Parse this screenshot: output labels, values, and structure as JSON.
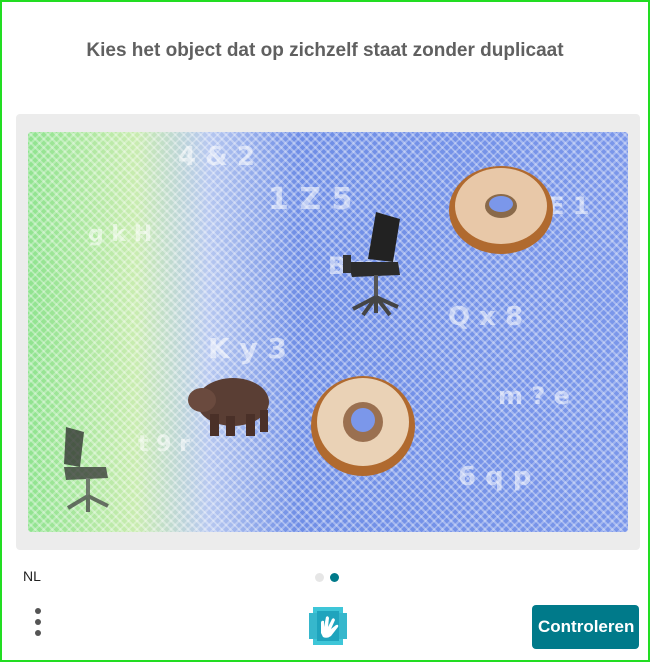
{
  "challenge": {
    "prompt": "Kies het object dat op zichzelf staat zonder duplicaat",
    "objects": [
      "donut",
      "office-chair",
      "donut",
      "hippo",
      "office-chair"
    ]
  },
  "footer": {
    "language": "NL",
    "page_indicator": {
      "total": 2,
      "current": 2
    },
    "verify_label": "Controleren"
  },
  "colors": {
    "accent": "#007a8a",
    "frame": "#22dd22"
  }
}
